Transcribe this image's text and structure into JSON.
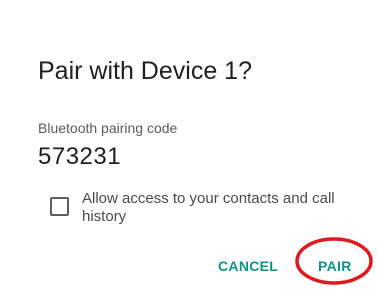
{
  "dialog": {
    "title": "Pair with Device 1?",
    "code_label": "Bluetooth pairing code",
    "code_value": "573231",
    "checkbox": {
      "label": "Allow access to your contacts and call history",
      "checked": false
    },
    "buttons": {
      "cancel": "CANCEL",
      "pair": "PAIR"
    }
  },
  "colors": {
    "accent": "#0d9488",
    "highlight_ring": "#e0191f",
    "title_text": "#1f1f1f",
    "secondary_text": "#5a5a5a"
  }
}
